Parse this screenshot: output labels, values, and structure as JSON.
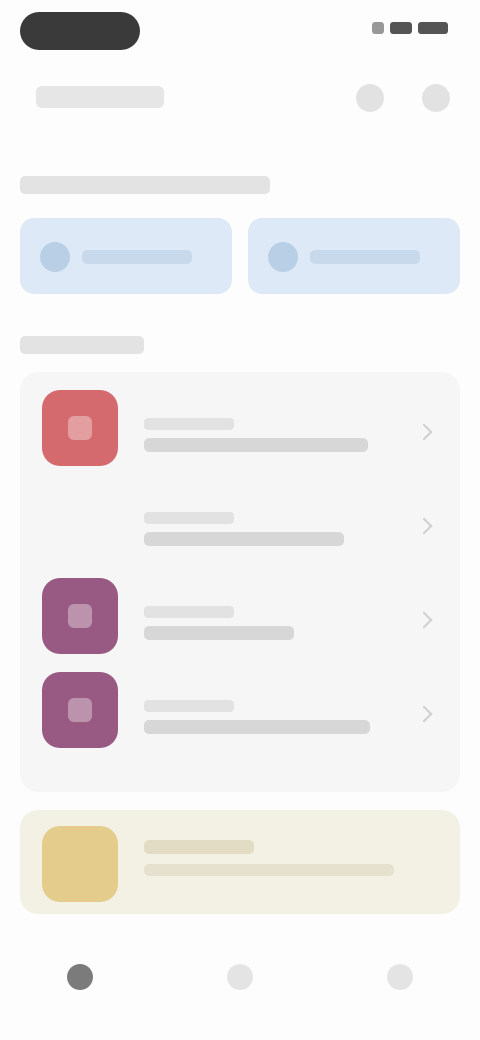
{
  "status_bar": {},
  "header": {},
  "quick_actions": [
    {},
    {}
  ],
  "apps": [
    {
      "icon": "app-red-icon",
      "color": "#d46a6e"
    },
    {
      "icon": "none",
      "color": ""
    },
    {
      "icon": "app-plum-icon",
      "color": "#985a82"
    },
    {
      "icon": "app-plum-icon",
      "color": "#985a82"
    }
  ],
  "promo": {
    "icon": "promo-gold-icon",
    "color": "#e4cc8c"
  },
  "bottom_nav": [
    {
      "icon": "home-icon",
      "active": true
    },
    {
      "icon": "discover-icon",
      "active": false
    },
    {
      "icon": "profile-icon",
      "active": false
    }
  ]
}
